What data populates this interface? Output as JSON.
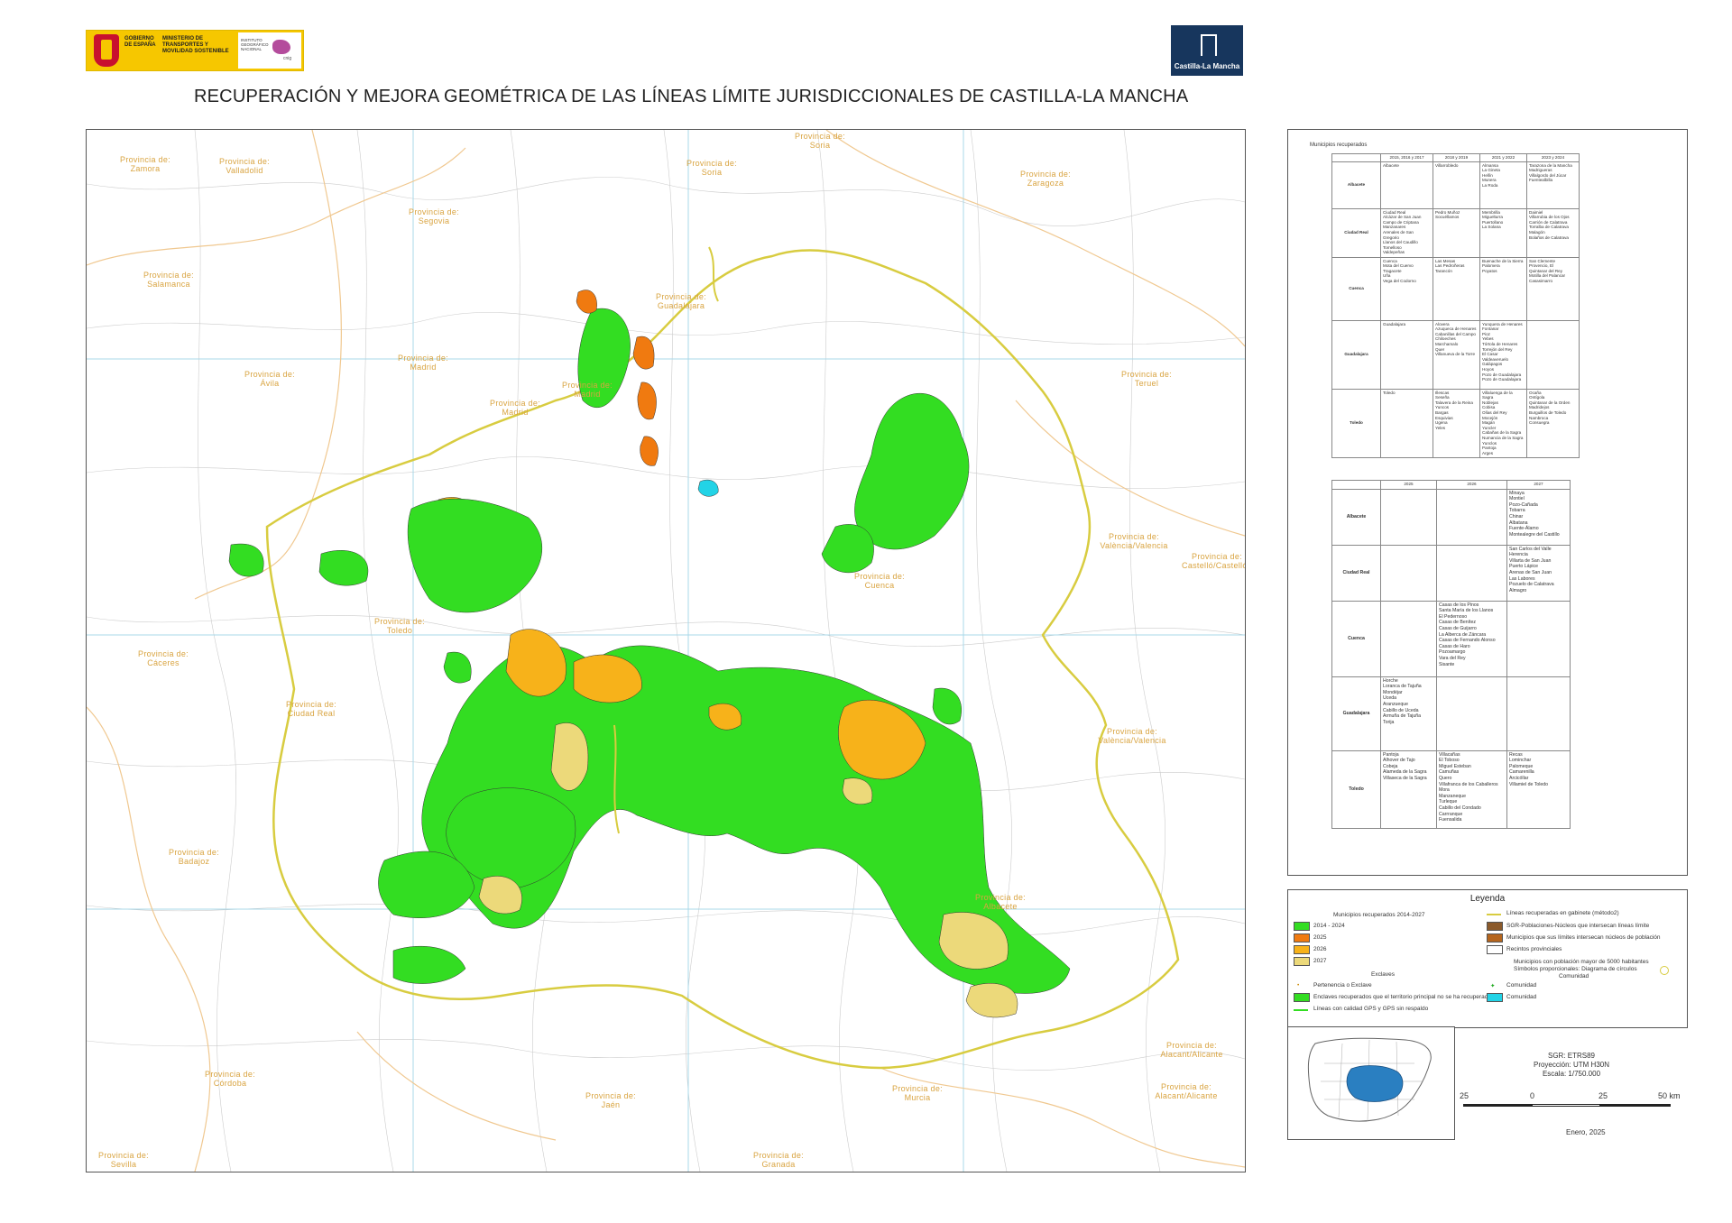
{
  "header": {
    "gov_logo_left": "GOBIERNO DE ESPAÑA",
    "gov_logo_ministry": "MINISTERIO DE TRANSPORTES Y MOVILIDAD SOSTENIBLE",
    "ign_label": "INSTITUTO GEOGRÁFICO NACIONAL",
    "cnig_label": "cnig",
    "clm_logo": "Castilla-La Mancha",
    "title": "RECUPERACIÓN Y MEJORA GEOMÉTRICA DE LAS LÍNEAS LÍMITE JURISDICCIONALES DE CASTILLA-LA MANCHA"
  },
  "map": {
    "province_labels": [
      {
        "line1": "Provincia de:",
        "line2": "Zamora"
      },
      {
        "line1": "Provincia de:",
        "line2": "Valladolid"
      },
      {
        "line1": "Provincia de:",
        "line2": "Soria"
      },
      {
        "line1": "Provincia de:",
        "line2": "Soria"
      },
      {
        "line1": "Provincia de:",
        "line2": "Zaragoza"
      },
      {
        "line1": "Provincia de:",
        "line2": "Segovia"
      },
      {
        "line1": "Provincia de:",
        "line2": "Salamanca"
      },
      {
        "line1": "Provincia de:",
        "line2": "Guadalajara"
      },
      {
        "line1": "Provincia de:",
        "line2": "Madrid"
      },
      {
        "line1": "Provincia de:",
        "line2": "Madrid"
      },
      {
        "line1": "Provincia de:",
        "line2": "Madrid"
      },
      {
        "line1": "Provincia de:",
        "line2": "Ávila"
      },
      {
        "line1": "Provincia de:",
        "line2": "Teruel"
      },
      {
        "line1": "Provincia de:",
        "line2": "València/Valencia"
      },
      {
        "line1": "Provincia de:",
        "line2": "Castelló/Castellón"
      },
      {
        "line1": "Provincia de:",
        "line2": "Cuenca"
      },
      {
        "line1": "Provincia de:",
        "line2": "Toledo"
      },
      {
        "line1": "Provincia de:",
        "line2": "Cáceres"
      },
      {
        "line1": "Provincia de:",
        "line2": "Ciudad Real"
      },
      {
        "line1": "Provincia de:",
        "line2": "València/Valencia"
      },
      {
        "line1": "Provincia de:",
        "line2": "Badajoz"
      },
      {
        "line1": "Provincia de:",
        "line2": "Albacete"
      },
      {
        "line1": "Provincia de:",
        "line2": "Alacant/Alicante"
      },
      {
        "line1": "Provincia de:",
        "line2": "Alacant/Alicante"
      },
      {
        "line1": "Provincia de:",
        "line2": "Córdoba"
      },
      {
        "line1": "Provincia de:",
        "line2": "Jaén"
      },
      {
        "line1": "Provincia de:",
        "line2": "Murcia"
      },
      {
        "line1": "Provincia de:",
        "line2": "Sevilla"
      },
      {
        "line1": "Provincia de:",
        "line2": "Granada"
      }
    ],
    "colors": {
      "green": "#33dd22",
      "orange": "#f07a10",
      "amber": "#f7b21a",
      "yellow": "#ecd97a",
      "cyan": "#22d3e6",
      "boundary": "#d8cc40",
      "grid": "#a8d8ea",
      "muni": "#c8c8c8",
      "prov_line": "#f0c890"
    }
  },
  "table1": {
    "caption": "Municipios recuperados",
    "columns": [
      "2015, 2016 y 2017",
      "2018 y 2019",
      "2021 y 2022",
      "2023 y 2024"
    ],
    "rows": [
      {
        "province": "Albacete",
        "cells": [
          "Albacete",
          "Villarrobledo",
          "Almansa\nLa Gineta\nHellín\nMunera\nLa Roda",
          "Tarazona de la Mancha\nMadrigueras\nVillalgordo del Júcar\nFuentealbilla"
        ]
      },
      {
        "province": "Ciudad Real",
        "cells": [
          "Ciudad Real\nAlcázar de San Juan\nCampo de Criptana\nManzanares\nArenales de San Gregorio\nLlanos del Caudillo\nTomelloso\nValdepeñas",
          "Pedro Muñoz\nSocuéllamos",
          "Membrilla\nMiguelturra\nPuertollano\nLa Solana",
          "Daimiel\nVillarrubia de los Ojos\nCarrión de Calatrava\nTorralba de Calatrava\nMalagón\nBolaños de Calatrava"
        ]
      },
      {
        "province": "Cuenca",
        "cells": [
          "Cuenca\nMota del Cuervo\nTragacete\nUña\nVega del Codorno",
          "Las Mesas\nLas Pedroñeras\nTarancón",
          "Buenache de la Sierra\nPalomera\nPoyatos",
          "San Clemente\nProvencio, El\nQuintanar del Rey\nMotilla del Palancar\nCasasimarro"
        ]
      },
      {
        "province": "Guadalajara",
        "cells": [
          "Guadalajara",
          "Alovera\nAzuqueca de Henares\nCabanillas del Campo\nChiloeches\nMarchamalo\nQuer\nVillanueva de la Torre",
          "Yunquera de Henares\nFontanar\nPioz\nYebes\nTórtola de Henares\nTorrejón del Rey\nEl Casar\nValdeaveruelo\nGalápagos\nHoyos\nPozo de Guadalajara\nPozo de Guadalajara",
          ""
        ]
      },
      {
        "province": "Toledo",
        "cells": [
          "Toledo",
          "Illescas\nSeseña\nTalavera de la Reina\nYuncos\nBargas\nEsquivias\nUgena\nYeles",
          "Villaluenga de la Sagra\nNoblejas\nCobisa\nOlías del Rey\nMocejón\nMagán\nYuncler\nCabañas de la Sagra\nNumancia de la Sagra\nYunclos\nPantoja\nArges",
          "Ocaña\nOntígola\nQuintanar de la Orden\nMadridejos\nBurguillos de Toledo\nNambroca\nConsuegra"
        ]
      }
    ]
  },
  "table2": {
    "columns": [
      "2025",
      "2026",
      "2027"
    ],
    "rows": [
      {
        "province": "Albacete",
        "cells": [
          "",
          "",
          "Minaya\nMontiel\nPozo-Cañada\nTobarra\nChinar\nAlbatana\nFuente-Álamo\nMontealegre del Castillo"
        ]
      },
      {
        "province": "Ciudad Real",
        "cells": [
          "",
          "",
          "San Carlos del Valle\nHerencia\nVillarta de San Juan\nPuerto Lápice\nArenas de San Juan\nLas Labores\nPozuelo de Calatrava\nAlmagro"
        ]
      },
      {
        "province": "Cuenca",
        "cells": [
          "",
          "Casas de los Pinos\nSanta María de los Llanos\nEl Pedernoso\nCasas de Benítez\nCasas de Guijarro\nLa Alberca de Záncara\nCasas de Fernando Alonso\nCasas de Haro\nPozoamargo\nVara del Rey\nSisante",
          ""
        ]
      },
      {
        "province": "Guadalajara",
        "cells": [
          "Horche\nLoranca de Tajuña\nMondéjar\nUceda\nAranzueque\nCabillo de Uceda\nArmuña de Tajuña\nTorija",
          "",
          ""
        ]
      },
      {
        "province": "Toledo",
        "cells": [
          "Pantoja\nAlhover de Tajo\nCobeja\nAlameda de la Sagra\nVillaseca de la Sagra",
          "Villacañas\nEl Toboso\nMiguel Esteban\nCamuñas\nQuero\nVillafranca de los Caballeros\nMora\nManzaneque\nTurleque\nCabillo del Condado\nCarrranque\nFuensalida",
          "Recas\nLominchar\nPalomeque\nCamarenilla\nArcicóllar\nVillamiel de Toledo"
        ]
      }
    ]
  },
  "legend": {
    "title": "Leyenda",
    "recovered_title": "Municipios recuperados 2014-2027",
    "recovered": [
      {
        "label": "2014 - 2024",
        "color": "#33dd22"
      },
      {
        "label": "2025",
        "color": "#f07a10"
      },
      {
        "label": "2026",
        "color": "#f7b21a"
      },
      {
        "label": "2027",
        "color": "#ecd97a"
      }
    ],
    "lines_label": "Líneas recuperadas en  gabinete (método2)",
    "sgr_label": "SGR-Poblaciones-Núcleos que intersecan líneas límite",
    "nucleos_label": "Municipios que sus límites intersecan núcleos de población",
    "rec_prov_label": "Recintos provinciales",
    "pop_title": "Municipios con población mayor de 5000 habitantes",
    "pop_subtitle": "Símbolos proporcionales: Diagrama de círculos",
    "comunidad_title": "Comunidad",
    "comunidad_point": "Comunidad",
    "comunidad_area": "Comunidad",
    "enclaves_title": "Exclaves",
    "pertenencia": "Pertenencia o Exclave",
    "enclaves_recuperados": "Enclaves recuperados que el territorio principal no se ha recuperado",
    "gps_line": "Líneas con calidad GPS y GPS sin respaldo",
    "sgr_color": "#8b5a2b",
    "nucleos_color": "#b5651d"
  },
  "scale": {
    "sgr": "SGR: ETRS89",
    "projection": "Proyección: UTM H30N",
    "scale": "Escala: 1/750.000",
    "ticks": [
      "25",
      "0",
      "25",
      "50 km"
    ],
    "date": "Enero, 2025"
  }
}
